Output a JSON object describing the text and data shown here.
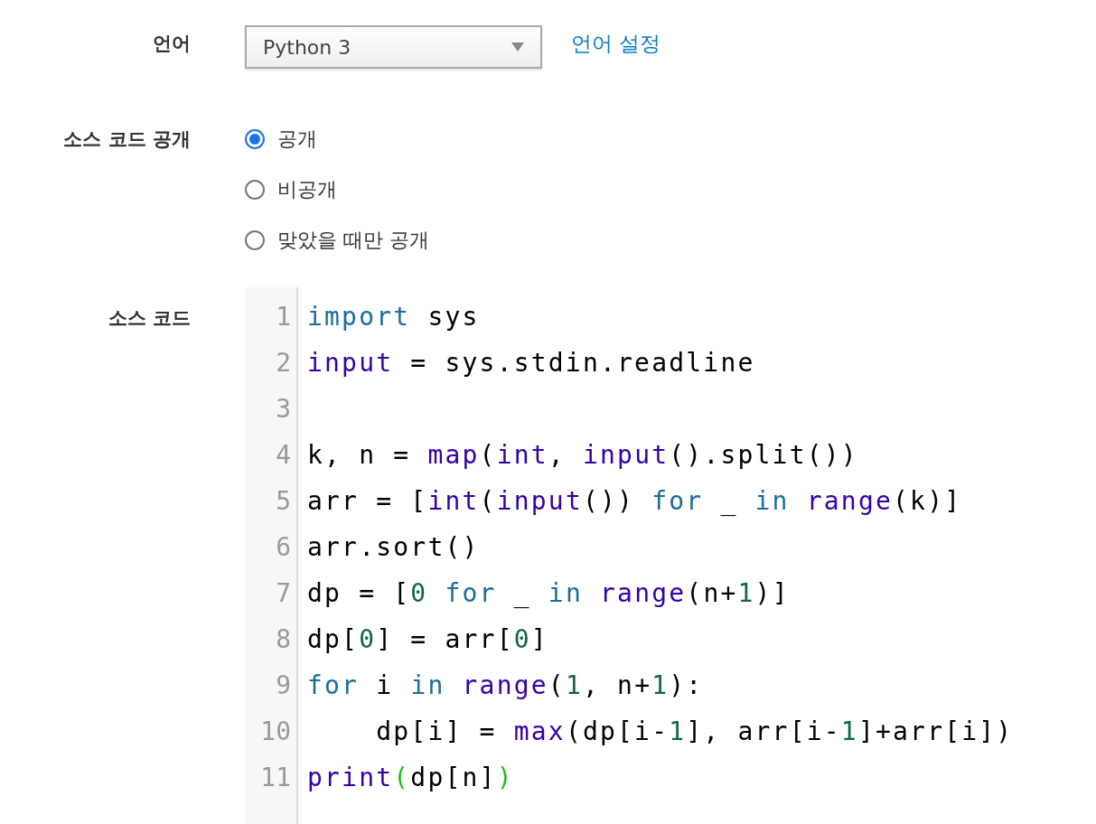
{
  "language": {
    "label": "언어",
    "value": "Python 3",
    "link": "언어 설정"
  },
  "visibility": {
    "label": "소스 코드 공개",
    "options": [
      {
        "label": "공개",
        "selected": true
      },
      {
        "label": "비공개",
        "selected": false
      },
      {
        "label": "맞았을 때만 공개",
        "selected": false
      }
    ]
  },
  "source": {
    "label": "소스 코드",
    "lines": [
      {
        "number": "1",
        "tokens": [
          {
            "kind": "keyword",
            "text": "import"
          },
          {
            "kind": "plain",
            "text": " sys"
          }
        ]
      },
      {
        "number": "2",
        "tokens": [
          {
            "kind": "builtin",
            "text": "input"
          },
          {
            "kind": "plain",
            "text": " = sys.stdin.readline"
          }
        ]
      },
      {
        "number": "3"
      },
      {
        "number": "4",
        "tokens": [
          {
            "kind": "plain",
            "text": "k, n = "
          },
          {
            "kind": "builtin",
            "text": "map"
          },
          {
            "kind": "plain",
            "text": "("
          },
          {
            "kind": "builtin",
            "text": "int"
          },
          {
            "kind": "plain",
            "text": ", "
          },
          {
            "kind": "builtin",
            "text": "input"
          },
          {
            "kind": "plain",
            "text": "().split())"
          }
        ]
      },
      {
        "number": "5",
        "tokens": [
          {
            "kind": "plain",
            "text": "arr = ["
          },
          {
            "kind": "builtin",
            "text": "int"
          },
          {
            "kind": "plain",
            "text": "("
          },
          {
            "kind": "builtin",
            "text": "input"
          },
          {
            "kind": "plain",
            "text": "()) "
          },
          {
            "kind": "keyword",
            "text": "for"
          },
          {
            "kind": "plain",
            "text": " _ "
          },
          {
            "kind": "keyword",
            "text": "in"
          },
          {
            "kind": "builtin",
            "text": " range"
          },
          {
            "kind": "plain",
            "text": "(k)]"
          }
        ]
      },
      {
        "number": "6",
        "tokens": [
          {
            "kind": "plain",
            "text": "arr.sort()"
          }
        ]
      },
      {
        "number": "7",
        "tokens": [
          {
            "kind": "plain",
            "text": "dp = ["
          },
          {
            "kind": "number",
            "text": "0"
          },
          {
            "kind": "keyword",
            "text": " for"
          },
          {
            "kind": "plain",
            "text": " _ "
          },
          {
            "kind": "keyword",
            "text": "in"
          },
          {
            "kind": "builtin",
            "text": " range"
          },
          {
            "kind": "plain",
            "text": "(n+"
          },
          {
            "kind": "number",
            "text": "1"
          },
          {
            "kind": "plain",
            "text": ")]"
          }
        ]
      },
      {
        "number": "8",
        "tokens": [
          {
            "kind": "plain",
            "text": "dp["
          },
          {
            "kind": "number",
            "text": "0"
          },
          {
            "kind": "plain",
            "text": "] = arr["
          },
          {
            "kind": "number",
            "text": "0"
          },
          {
            "kind": "plain",
            "text": "]"
          }
        ]
      },
      {
        "number": "9",
        "tokens": [
          {
            "kind": "keyword",
            "text": "for"
          },
          {
            "kind": "plain",
            "text": " i "
          },
          {
            "kind": "keyword",
            "text": "in"
          },
          {
            "kind": "builtin",
            "text": " range"
          },
          {
            "kind": "plain",
            "text": "("
          },
          {
            "kind": "number",
            "text": "1"
          },
          {
            "kind": "plain",
            "text": ", n+"
          },
          {
            "kind": "number",
            "text": "1"
          },
          {
            "kind": "plain",
            "text": "):"
          }
        ]
      },
      {
        "number": "10",
        "tokens": [
          {
            "kind": "plain",
            "text": "    dp[i] = "
          },
          {
            "kind": "builtin",
            "text": "max"
          },
          {
            "kind": "plain",
            "text": "(dp[i-"
          },
          {
            "kind": "number",
            "text": "1"
          },
          {
            "kind": "plain",
            "text": "], arr[i-"
          },
          {
            "kind": "number",
            "text": "1"
          },
          {
            "kind": "plain",
            "text": "]+arr[i])"
          }
        ]
      },
      {
        "number": "11",
        "tokens": [
          {
            "kind": "builtin",
            "text": "print"
          },
          {
            "kind": "match",
            "text": "("
          },
          {
            "kind": "plain",
            "text": "dp[n]"
          },
          {
            "kind": "match",
            "text": ")"
          }
        ]
      }
    ]
  }
}
